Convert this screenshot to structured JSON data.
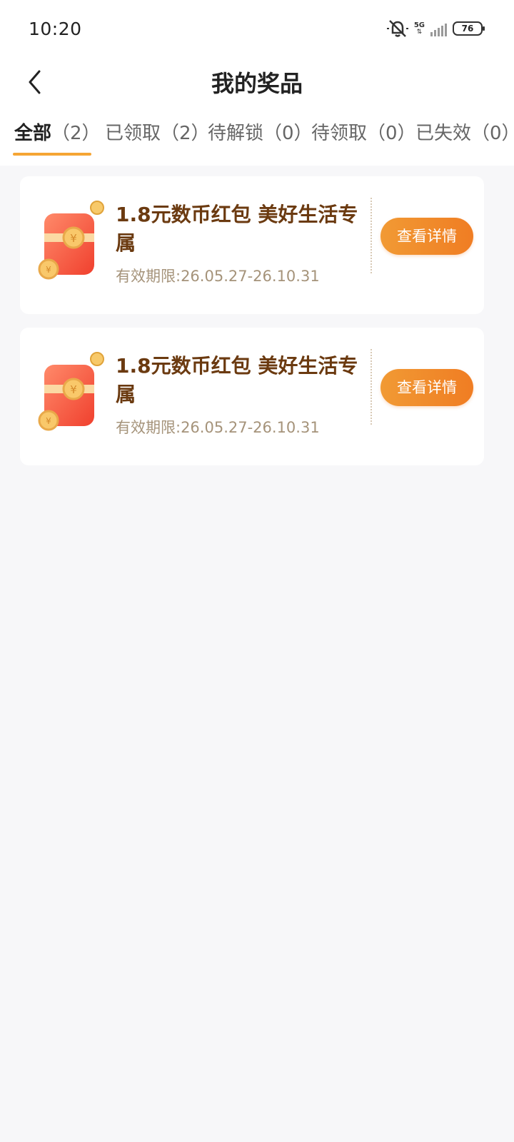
{
  "status_bar": {
    "time": "10:20",
    "network": "5G",
    "battery": "76"
  },
  "header": {
    "title": "我的奖品"
  },
  "tabs": [
    {
      "label": "全部",
      "count": "（2）",
      "active": true
    },
    {
      "label": "已领取",
      "count": "（2）",
      "active": false
    },
    {
      "label": "待解锁",
      "count": "（0）",
      "active": false
    },
    {
      "label": "待领取",
      "count": "（0）",
      "active": false
    },
    {
      "label": "已失效",
      "count": "（0）",
      "active": false
    }
  ],
  "prizes": [
    {
      "title": "1.8元数币红包 美好生活专属",
      "validity": "有效期限:26.05.27-26.10.31",
      "button": "查看详情",
      "icon": "red-envelope-icon"
    },
    {
      "title": "1.8元数币红包 美好生活专属",
      "validity": "有效期限:26.05.27-26.10.31",
      "button": "查看详情",
      "icon": "red-envelope-icon"
    }
  ],
  "colors": {
    "accent": "#f5a534",
    "button": "#f0862a",
    "title_text": "#6b3a10",
    "date_text": "#a5937a",
    "background": "#f7f7f9"
  }
}
